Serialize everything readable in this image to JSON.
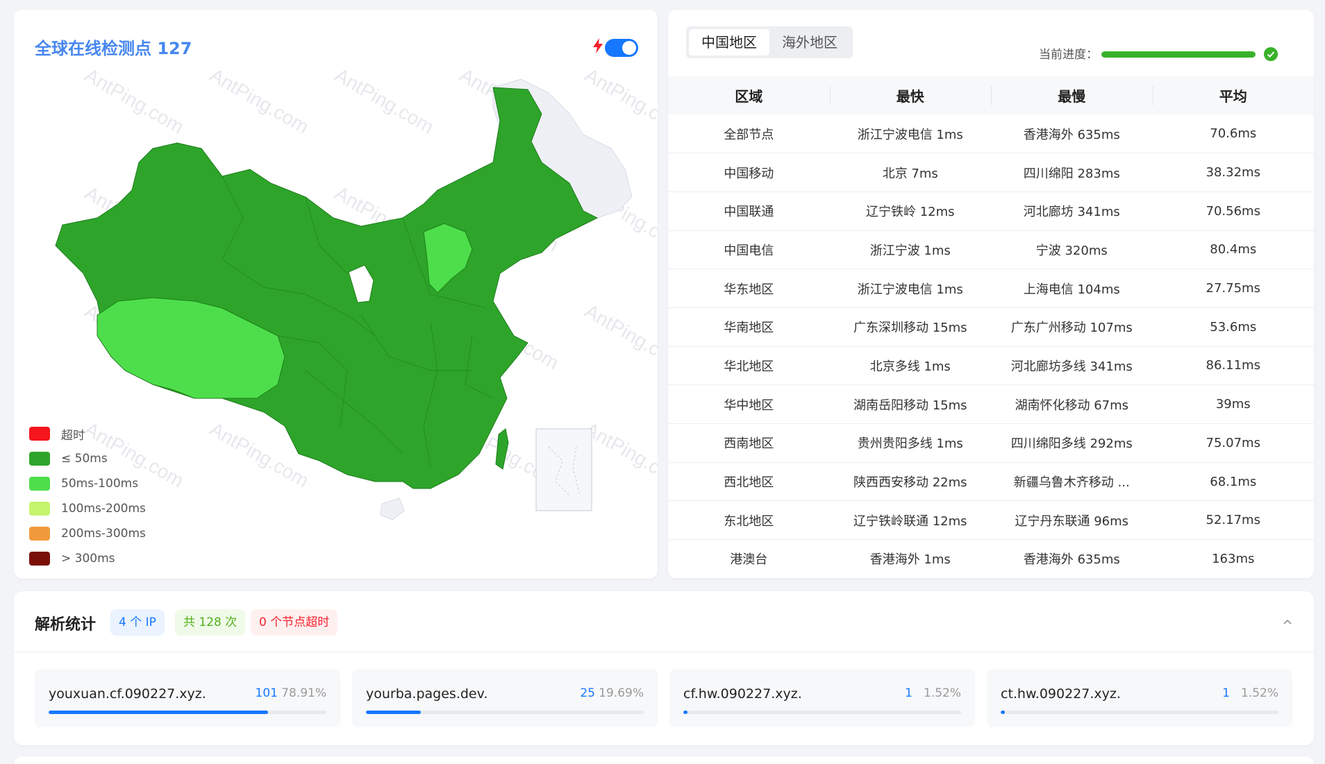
{
  "map": {
    "title": "全球在线检测点 127",
    "realtime_enabled": true,
    "watermark_text": "AntPing.com",
    "legend": [
      {
        "label": "超时",
        "color": "#f5151b"
      },
      {
        "label": "≤ 50ms",
        "color": "#2ea52a"
      },
      {
        "label": "50ms-100ms",
        "color": "#4ede4b"
      },
      {
        "label": "100ms-200ms",
        "color": "#c5f46d"
      },
      {
        "label": "200ms-300ms",
        "color": "#f0993c"
      },
      {
        "label": "> 300ms",
        "color": "#7a1109"
      }
    ]
  },
  "results": {
    "tabs": [
      {
        "label": "中国地区",
        "active": true
      },
      {
        "label": "海外地区",
        "active": false
      }
    ],
    "progress_label": "当前进度：",
    "progress": 1.0,
    "columns": [
      "区域",
      "最快",
      "最慢",
      "平均"
    ],
    "rows": [
      [
        "全部节点",
        "浙江宁波电信 1ms",
        "香港海外 635ms",
        "70.6ms"
      ],
      [
        "中国移动",
        "北京 7ms",
        "四川绵阳 283ms",
        "38.32ms"
      ],
      [
        "中国联通",
        "辽宁铁岭 12ms",
        "河北廊坊 341ms",
        "70.56ms"
      ],
      [
        "中国电信",
        "浙江宁波 1ms",
        "宁波 320ms",
        "80.4ms"
      ],
      [
        "华东地区",
        "浙江宁波电信 1ms",
        "上海电信 104ms",
        "27.75ms"
      ],
      [
        "华南地区",
        "广东深圳移动 15ms",
        "广东广州移动 107ms",
        "53.6ms"
      ],
      [
        "华北地区",
        "北京多线 1ms",
        "河北廊坊多线 341ms",
        "86.11ms"
      ],
      [
        "华中地区",
        "湖南岳阳移动 15ms",
        "湖南怀化移动 67ms",
        "39ms"
      ],
      [
        "西南地区",
        "贵州贵阳多线 1ms",
        "四川绵阳多线 292ms",
        "75.07ms"
      ],
      [
        "西北地区",
        "陕西西安移动 22ms",
        "新疆乌鲁木齐移动 ...",
        "68.1ms"
      ],
      [
        "东北地区",
        "辽宁铁岭联通 12ms",
        "辽宁丹东联通 96ms",
        "52.17ms"
      ],
      [
        "港澳台",
        "香港海外 1ms",
        "香港海外 635ms",
        "163ms"
      ]
    ]
  },
  "stats": {
    "title": "解析统计",
    "badge_ip": "4 个 IP",
    "badge_count": "共 128 次",
    "badge_timeout": "0 个节点超时",
    "hosts": [
      {
        "name": "youxuan.cf.090227.xyz.",
        "count": "101",
        "percent": "78.91%",
        "fraction": 0.7891
      },
      {
        "name": "yourba.pages.dev.",
        "count": "25",
        "percent": "19.69%",
        "fraction": 0.1969
      },
      {
        "name": "cf.hw.090227.xyz.",
        "count": "1",
        "percent": "1.52%",
        "fraction": 0.0152
      },
      {
        "name": "ct.hw.090227.xyz.",
        "count": "1",
        "percent": "1.52%",
        "fraction": 0.0152
      }
    ]
  }
}
